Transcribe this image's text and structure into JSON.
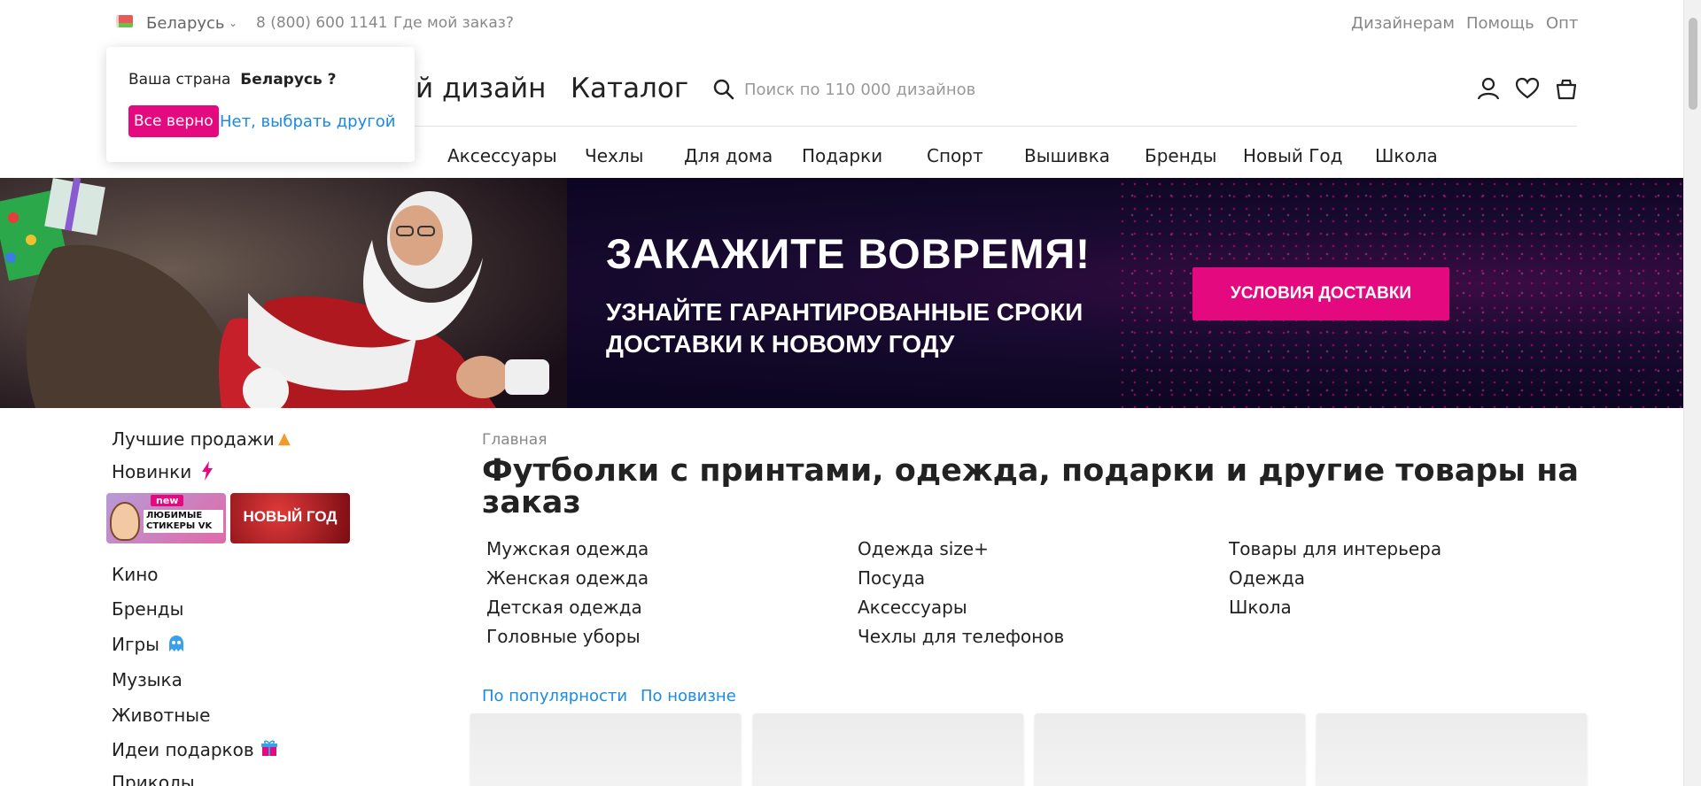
{
  "topbar": {
    "country": "Беларусь",
    "phone": "8 (800) 600 1141",
    "order_link": "Где мой заказ?",
    "designers": "Дизайнерам",
    "help": "Помощь",
    "wholesale": "Опт"
  },
  "header": {
    "logo_partial": "ой дизайн",
    "catalog": "Каталог",
    "search_placeholder": "Поиск по 110 000 дизайнов"
  },
  "nav": [
    "Аксессуары",
    "Чехлы",
    "Для дома",
    "Подарки",
    "Спорт",
    "Вышивка",
    "Бренды",
    "Новый Год",
    "Школа"
  ],
  "country_popover": {
    "question_prefix": "Ваша страна",
    "country": "Беларусь ?",
    "confirm": "Все верно",
    "choose_other": "Нет, выбрать другой"
  },
  "banner": {
    "title": "ЗАКАЖИТЕ ВОВРЕМЯ!",
    "subtitle_line1": "УЗНАЙТЕ ГАРАНТИРОВАННЫЕ СРОКИ",
    "subtitle_line2": "ДОСТАВКИ К НОВОМУ ГОДУ",
    "button": "УСЛОВИЯ ДОСТАВКИ",
    "accent_color": "#e5097f"
  },
  "sidebar": {
    "best": "Лучшие продажи",
    "new": "Новинки",
    "promo_vk_badge": "new",
    "promo_vk": "ЛЮБИМЫЕ СТИКЕРЫ VK",
    "promo_ny": "НОВЫЙ ГОД",
    "items": [
      "Кино",
      "Бренды",
      "Игры",
      "Музыка",
      "Животные",
      "Идеи подарков",
      "Приколы"
    ]
  },
  "main": {
    "breadcrumb": "Главная",
    "title": "Футболки с принтами, одежда, подарки и другие товары на заказ",
    "categories_col1": [
      "Мужская одежда",
      "Женская одежда",
      "Детская одежда",
      "Головные уборы"
    ],
    "categories_col2": [
      "Одежда size+",
      "Посуда",
      "Аксессуары",
      "Чехлы для телефонов"
    ],
    "categories_col3": [
      "Товары для интерьера",
      "Одежда",
      "Школа"
    ],
    "sort_popular": "По популярности",
    "sort_new": "По новизне"
  }
}
